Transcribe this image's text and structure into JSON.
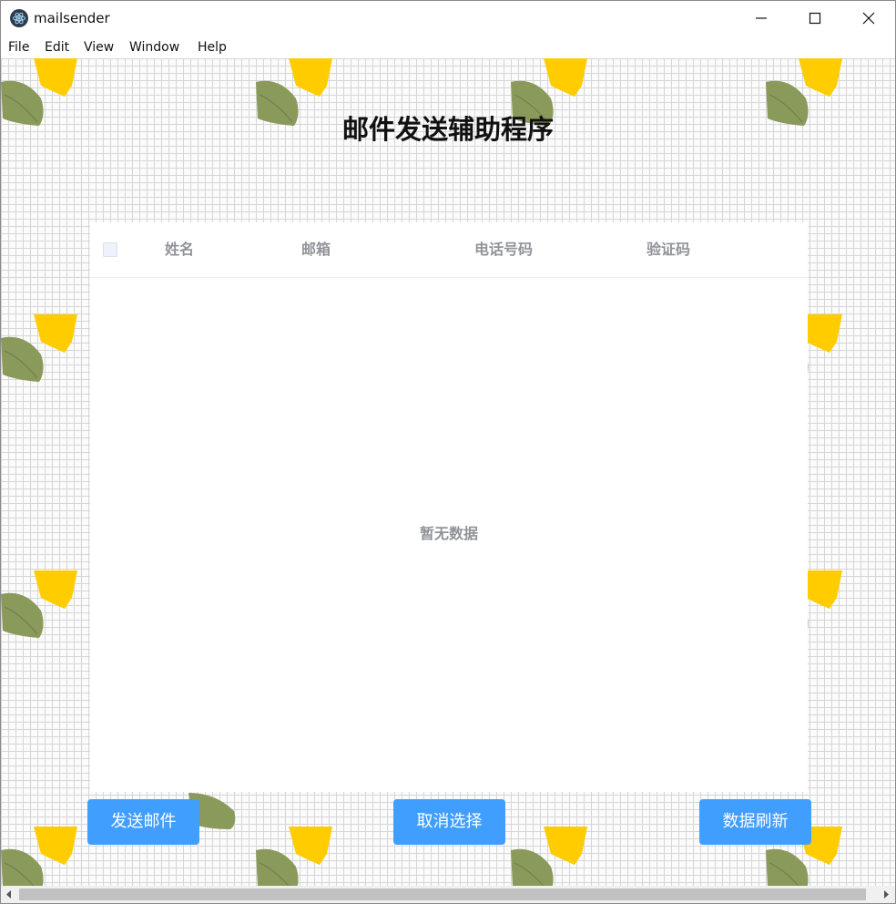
{
  "window": {
    "title": "mailsender",
    "app_icon": "electron-icon"
  },
  "menu": {
    "items": [
      "File",
      "Edit",
      "View",
      "Window",
      "Help"
    ]
  },
  "main": {
    "title": "邮件发送辅助程序"
  },
  "table": {
    "columns": [
      "姓名",
      "邮箱",
      "电话号码",
      "验证码"
    ],
    "empty_text": "暂无数据",
    "header_color": "#909399"
  },
  "buttons": {
    "send": "发送邮件",
    "cancel": "取消选择",
    "refresh": "数据刷新",
    "color": "#409eff"
  },
  "decor": {
    "leaf_green": "#8a9a5b",
    "leaf_yellow": "#ffcc00"
  }
}
